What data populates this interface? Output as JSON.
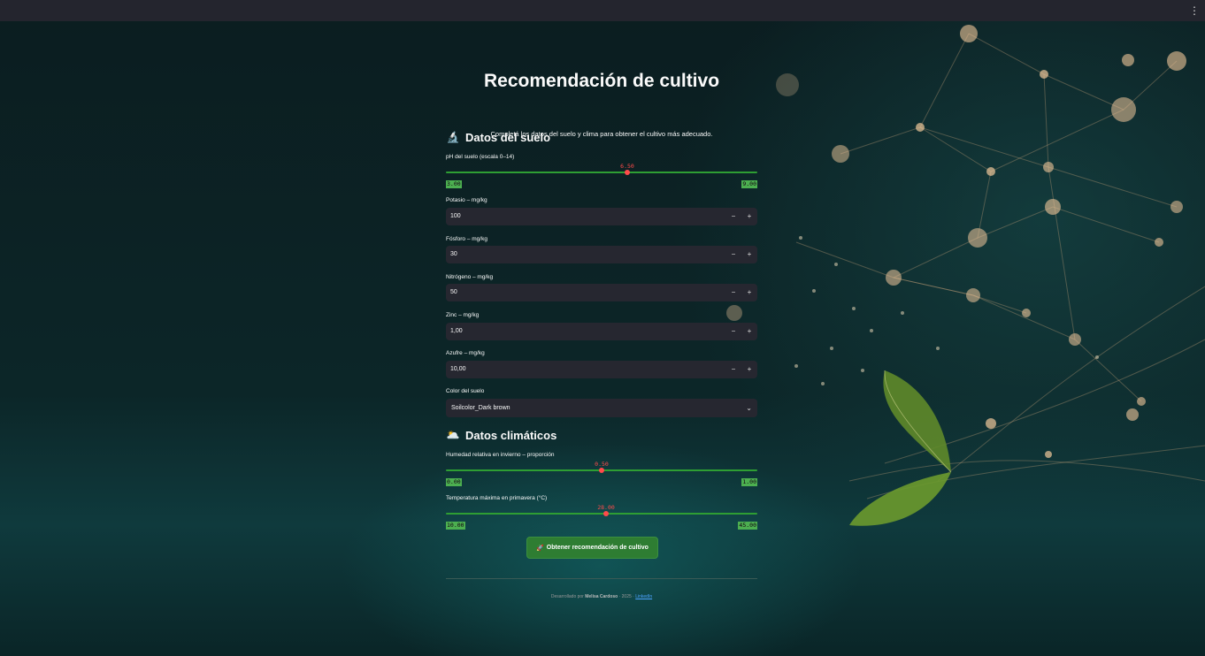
{
  "header": {
    "menu_icon": "⋮"
  },
  "page": {
    "title": "Recomendación de cultivo",
    "subtitle": "Completá los datos del suelo y clima para obtener el cultivo más adecuado."
  },
  "soil": {
    "heading": "Datos del suelo",
    "heading_icon": "🔬",
    "ph": {
      "label": "pH del suelo (escala 0–14)",
      "value": "6.50",
      "min": "3.00",
      "max": "9.00",
      "fraction": 0.583
    },
    "potasio": {
      "label": "Potasio – mg/kg",
      "value": "100"
    },
    "fosforo": {
      "label": "Fósforo – mg/kg",
      "value": "30"
    },
    "nitrogeno": {
      "label": "Nitrógeno – mg/kg",
      "value": "50"
    },
    "zinc": {
      "label": "Zinc – mg/kg",
      "value": "1,00"
    },
    "azufre": {
      "label": "Azufre – mg/kg",
      "value": "10,00"
    },
    "color": {
      "label": "Color del suelo",
      "value": "Soilcolor_Dark brown"
    }
  },
  "climate": {
    "heading": "Datos climáticos",
    "heading_icon": "🌥️",
    "humedad": {
      "label": "Humedad relativa en invierno – proporción",
      "value": "0.50",
      "min": "0.00",
      "max": "1.00",
      "fraction": 0.5
    },
    "temp": {
      "label": "Temperatura máxima en primavera (°C)",
      "value": "28.00",
      "min": "10.00",
      "max": "45.00",
      "fraction": 0.514
    }
  },
  "stepper": {
    "minus": "−",
    "plus": "+"
  },
  "select_chevron": "⌄",
  "button": {
    "icon": "🚀",
    "label": "Obtener recomendación de cultivo"
  },
  "footer": {
    "prefix": "Desarrollado por",
    "author": "Melisa Cardoso",
    "year": "· 2025 ·",
    "link": "LinkedIn"
  },
  "colors": {
    "accent_green": "#2e7d32",
    "thumb_red": "#ff4b4b",
    "input_bg": "#262730"
  }
}
